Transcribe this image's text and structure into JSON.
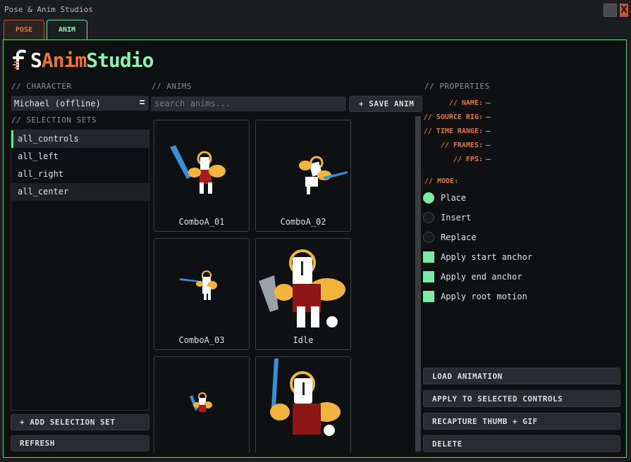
{
  "window": {
    "title": "Pose & Anim Studios",
    "close_label": "X"
  },
  "tabs": [
    {
      "label": "POSE"
    },
    {
      "label": "ANIM"
    }
  ],
  "logo": {
    "text_parts": [
      "S",
      "Anim",
      "Studio"
    ]
  },
  "character": {
    "section_label": "// CHARACTER",
    "value": "Michael  (offline)"
  },
  "selection_sets": {
    "section_label": "// SELECTION SETS",
    "items": [
      {
        "label": "all_controls",
        "active": true
      },
      {
        "label": "all_left"
      },
      {
        "label": "all_right"
      },
      {
        "label": "all_center"
      }
    ],
    "add_button": "+ ADD SELECTION SET",
    "refresh_button": "REFRESH"
  },
  "anims": {
    "section_label": "// ANIMS",
    "search_placeholder": "search anims...",
    "save_button": "+ SAVE ANIM",
    "items": [
      {
        "label": "ComboA_01"
      },
      {
        "label": "ComboA_02"
      },
      {
        "label": "ComboA_03"
      },
      {
        "label": "Idle"
      },
      {
        "label": ""
      },
      {
        "label": ""
      }
    ]
  },
  "properties": {
    "section_label": "// PROPERTIES",
    "fields": [
      {
        "label": "// NAME:",
        "value": "—"
      },
      {
        "label": "// SOURCE RIG:",
        "value": "—"
      },
      {
        "label": "// TIME RANGE:",
        "value": "—"
      },
      {
        "label": "// FRAMES:",
        "value": "—"
      },
      {
        "label": "// FPS:",
        "value": "—"
      }
    ],
    "mode_label": "// MODE:",
    "modes": [
      {
        "label": "Place",
        "selected": true
      },
      {
        "label": "Insert",
        "selected": false
      },
      {
        "label": "Replace",
        "selected": false
      }
    ],
    "options": [
      {
        "label": "Apply start anchor",
        "checked": true
      },
      {
        "label": "Apply end anchor",
        "checked": true
      },
      {
        "label": "Apply root motion",
        "checked": true
      }
    ],
    "actions": [
      {
        "label": "LOAD ANIMATION"
      },
      {
        "label": "APPLY TO SELECTED CONTROLS"
      },
      {
        "label": "RECAPTURE THUMB + GIF"
      },
      {
        "label": "DELETE"
      }
    ]
  },
  "colors": {
    "accent_green": "#6fdc9c",
    "accent_orange": "#e9743f",
    "background": "#0f1012"
  }
}
